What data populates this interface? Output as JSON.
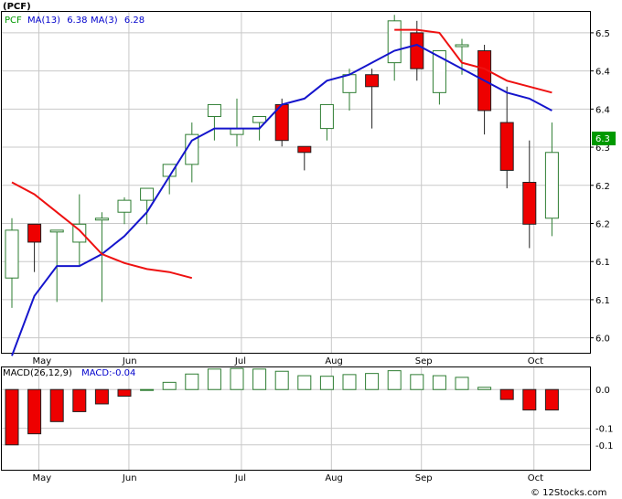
{
  "header": {
    "ticker": "(PCF)",
    "legend": [
      {
        "label": "PCF",
        "color": "#009900"
      },
      {
        "label": "MA(13)",
        "value": "6.38",
        "color": "#0000cc"
      },
      {
        "label": "MA(3)",
        "value": "6.28",
        "color": "#0000cc"
      }
    ]
  },
  "price_badge": "6.3",
  "credit": "© 12Stocks.com",
  "colors": {
    "up": "#2e7d32",
    "down": "#ee0000",
    "ma_slow": "#1515cc",
    "ma_fast": "#ee1111",
    "grid": "#c8c8c8"
  },
  "chart_data": [
    {
      "type": "candlestick",
      "title": "(PCF)",
      "y_ticks": [
        6.0,
        6.1,
        6.1,
        6.2,
        6.2,
        6.3,
        6.4,
        6.4,
        6.5
      ],
      "ylim": [
        5.975,
        6.545
      ],
      "x_ticks": [
        "May",
        "Jun",
        "Jul",
        "Aug",
        "Sep",
        "Oct"
      ],
      "x_tick_index": [
        1.2,
        5.2,
        10.2,
        14.2,
        18.2,
        23.2
      ],
      "grid": true,
      "candles": [
        {
          "o": 6.1,
          "h": 6.2,
          "l": 6.05,
          "c": 6.18
        },
        {
          "o": 6.19,
          "h": 6.19,
          "l": 6.11,
          "c": 6.16
        },
        {
          "o": 6.18,
          "h": 6.18,
          "l": 6.06,
          "c": 6.18
        },
        {
          "o": 6.16,
          "h": 6.24,
          "l": 6.12,
          "c": 6.19
        },
        {
          "o": 6.2,
          "h": 6.21,
          "l": 6.06,
          "c": 6.2
        },
        {
          "o": 6.21,
          "h": 6.235,
          "l": 6.19,
          "c": 6.23
        },
        {
          "o": 6.23,
          "h": 6.25,
          "l": 6.19,
          "c": 6.25
        },
        {
          "o": 6.27,
          "h": 6.29,
          "l": 6.24,
          "c": 6.29
        },
        {
          "o": 6.29,
          "h": 6.36,
          "l": 6.26,
          "c": 6.34
        },
        {
          "o": 6.37,
          "h": 6.39,
          "l": 6.33,
          "c": 6.39
        },
        {
          "o": 6.34,
          "h": 6.4,
          "l": 6.32,
          "c": 6.35
        },
        {
          "o": 6.36,
          "h": 6.37,
          "l": 6.33,
          "c": 6.37
        },
        {
          "o": 6.39,
          "h": 6.4,
          "l": 6.32,
          "c": 6.33
        },
        {
          "o": 6.32,
          "h": 6.32,
          "l": 6.28,
          "c": 6.31
        },
        {
          "o": 6.35,
          "h": 6.39,
          "l": 6.33,
          "c": 6.39
        },
        {
          "o": 6.41,
          "h": 6.45,
          "l": 6.38,
          "c": 6.44
        },
        {
          "o": 6.44,
          "h": 6.45,
          "l": 6.35,
          "c": 6.42
        },
        {
          "o": 6.46,
          "h": 6.54,
          "l": 6.43,
          "c": 6.53
        },
        {
          "o": 6.51,
          "h": 6.53,
          "l": 6.43,
          "c": 6.45
        },
        {
          "o": 6.41,
          "h": 6.48,
          "l": 6.39,
          "c": 6.48
        },
        {
          "o": 6.49,
          "h": 6.5,
          "l": 6.44,
          "c": 6.49
        },
        {
          "o": 6.48,
          "h": 6.49,
          "l": 6.34,
          "c": 6.38
        },
        {
          "o": 6.36,
          "h": 6.42,
          "l": 6.25,
          "c": 6.28
        },
        {
          "o": 6.26,
          "h": 6.33,
          "l": 6.15,
          "c": 6.19
        },
        {
          "o": 6.2,
          "h": 6.36,
          "l": 6.17,
          "c": 6.31
        }
      ],
      "series": [
        {
          "values": [
            5.97,
            6.07,
            6.12,
            6.12,
            6.14,
            6.17,
            6.21,
            6.27,
            6.33,
            6.35,
            6.35,
            6.35,
            6.39,
            6.4,
            6.43,
            6.44,
            6.46,
            6.48,
            6.49,
            6.47,
            6.45,
            6.43,
            6.41,
            6.4,
            6.38
          ],
          "color": "#1515cc"
        },
        {
          "values": [
            6.26,
            6.24,
            6.21,
            6.18,
            6.14,
            6.125,
            6.115,
            6.11,
            6.1,
            null,
            null,
            null,
            null,
            null,
            null,
            null,
            null,
            6.515,
            6.515,
            6.51,
            6.46,
            6.45,
            6.43,
            6.42,
            6.41
          ],
          "color": "#ee1111"
        }
      ]
    },
    {
      "type": "bar",
      "title": "MACD(26,12,9)",
      "annotation": "MACD:-0.04",
      "y_ticks": [
        0.0,
        -0.1,
        -0.1
      ],
      "ylim": [
        -0.145,
        0.04
      ],
      "x_ticks": [
        "May",
        "Jun",
        "Jul",
        "Aug",
        "Sep",
        "Oct"
      ],
      "values": [
        -0.1,
        -0.08,
        -0.058,
        -0.04,
        -0.026,
        -0.012,
        0.0,
        0.013,
        0.028,
        0.037,
        0.038,
        0.037,
        0.033,
        0.025,
        0.024,
        0.027,
        0.029,
        0.034,
        0.027,
        0.025,
        0.022,
        0.004,
        -0.018,
        -0.037,
        -0.037
      ]
    }
  ]
}
